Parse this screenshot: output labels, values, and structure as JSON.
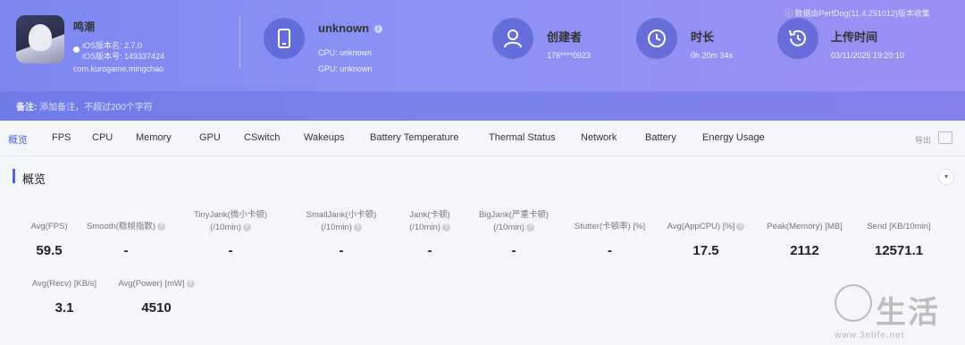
{
  "header": {
    "app": {
      "name": "鸣潮",
      "version_name": "iOS版本名: 2.7.0",
      "version_code": "iOS版本号: 149337424",
      "bundle": "com.kurogame.mingchao"
    },
    "device": {
      "name": "unknown",
      "cpu": "CPU: unknown",
      "gpu": "GPU: unknown"
    },
    "creator": {
      "title": "创建者",
      "value": "176****0923"
    },
    "duration": {
      "title": "时长",
      "value": "0h 20m 34s"
    },
    "upload": {
      "title": "上传时间",
      "value": "03/11/2025 19:20:10"
    },
    "export_tip": "数据由PerfDog(11.4.251012)版本收集",
    "note_label": "备注:",
    "note_placeholder": "添加备注，不超过200个字符"
  },
  "tabs": [
    "概览",
    "FPS",
    "CPU",
    "Memory",
    "GPU",
    "CSwitch",
    "Wakeups",
    "Battery Temperature",
    "Thermal Status",
    "Network",
    "Battery",
    "Energy Usage"
  ],
  "active_tab": "概览",
  "export_label": "导出",
  "section": {
    "title": "概览",
    "collapse_icon": "▾"
  },
  "metrics": [
    {
      "label1": "Avg(FPS)",
      "label2": "",
      "value": "59.5"
    },
    {
      "label1": "Smooth(稳帧指数)",
      "label2": "",
      "value": "-"
    },
    {
      "label1": "TinyJank(微小卡顿)",
      "label2": "(/10min)",
      "value": "-"
    },
    {
      "label1": "SmallJank(小卡顿)",
      "label2": "(/10min)",
      "value": "-"
    },
    {
      "label1": "Jank(卡顿)",
      "label2": "(/10min)",
      "value": "-"
    },
    {
      "label1": "BigJank(严重卡顿)",
      "label2": "(/10min)",
      "value": "-"
    },
    {
      "label1": "Stutter(卡顿率) [%]",
      "label2": "",
      "value": "-"
    },
    {
      "label1": "Avg(AppCPU) [%]",
      "label2": "",
      "value": "17.5"
    },
    {
      "label1": "Peak(Memory) [MB]",
      "label2": "",
      "value": "2112"
    },
    {
      "label1": "Send [KB/10min]",
      "label2": "",
      "value": "12571.1"
    },
    {
      "label1": "Avg(Recv) [KB/s]",
      "label2": "",
      "value": "3.1"
    },
    {
      "label1": "Avg(Power) [mW]",
      "label2": "",
      "value": "4510"
    }
  ],
  "watermark": {
    "text": "生活",
    "url": "www.3elife.net"
  },
  "colors": {
    "header_start": "#7d86f0",
    "header_end": "#9a8ff4",
    "accent": "#4b63e6"
  }
}
